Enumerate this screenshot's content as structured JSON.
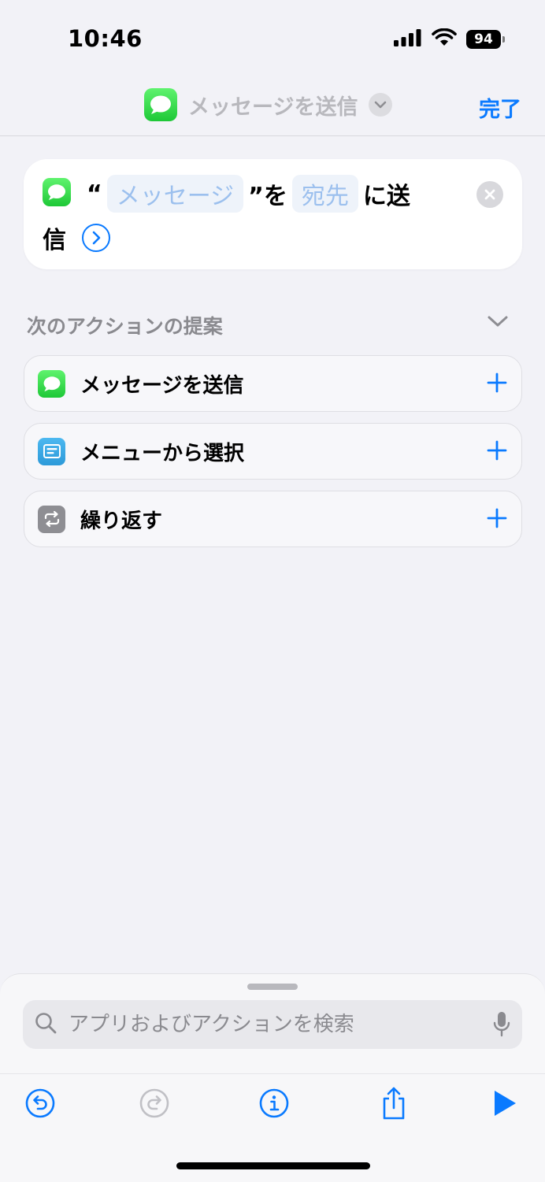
{
  "status_bar": {
    "time": "10:46",
    "battery": "94",
    "icons": [
      "signal-icon",
      "wifi-icon",
      "battery-icon"
    ]
  },
  "header": {
    "title": "メッセージを送信",
    "done_label": "完了",
    "app_icon": "messages-app-icon"
  },
  "action": {
    "open_quote": "“",
    "message_placeholder": "メッセージ",
    "close_quote": "”を",
    "recipient_placeholder": "宛先",
    "suffix_line1": "に送",
    "suffix_line2": "信"
  },
  "suggestions": {
    "header": "次のアクションの提案",
    "items": [
      {
        "label": "メッセージを送信",
        "icon": "messages-icon",
        "color": "#30d158"
      },
      {
        "label": "メニューから選択",
        "icon": "menu-icon",
        "color": "#34aadc"
      },
      {
        "label": "繰り返す",
        "icon": "repeat-icon",
        "color": "#8e8e93"
      }
    ]
  },
  "search": {
    "placeholder": "アプリおよびアクションを検索"
  },
  "toolbar": {
    "items": [
      "undo-icon",
      "redo-icon",
      "info-icon",
      "share-icon",
      "play-icon"
    ]
  },
  "colors": {
    "accent": "#0a7aff",
    "background": "#f2f2f7"
  }
}
